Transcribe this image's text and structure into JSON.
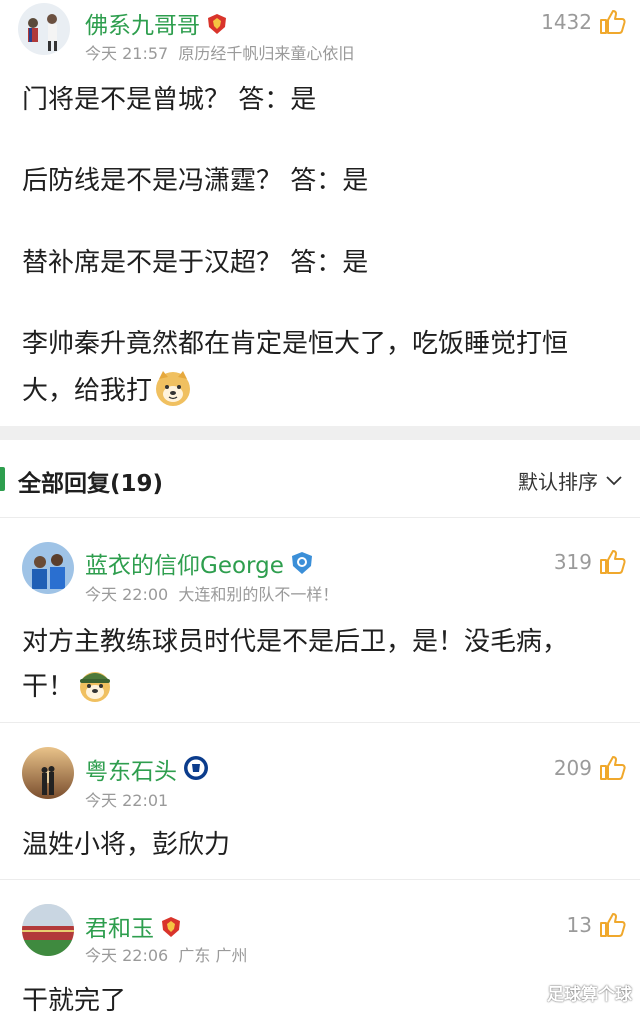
{
  "post": {
    "username": "佛系九哥哥",
    "time": "今天 21:57",
    "signature": "原历经千帆归来童心依旧",
    "likes": "1432",
    "lines": [
      "门将是不是曾城？ 答：是",
      "后防线是不是冯潇霆？ 答：是",
      "替补席是不是于汉超？ 答：是",
      "李帅秦升竟然都在肯定是恒大了，吃饭睡觉打恒",
      "大，给我打"
    ]
  },
  "replies_header": {
    "title": "全部回复(19)",
    "sort_label": "默认排序"
  },
  "replies": [
    {
      "username": "蓝衣的信仰George",
      "time": "今天 22:00",
      "signature": "大连和别的队不一样！",
      "likes": "319",
      "lines": [
        "对方主教练球员时代是不是后卫，是！没毛病，",
        "干！"
      ]
    },
    {
      "username": "粤东石头",
      "time": "今天 22:01",
      "signature": "",
      "likes": "209",
      "lines": [
        "温姓小将，彭欣力"
      ]
    },
    {
      "username": "君和玉",
      "time": "今天 22:06",
      "signature": "广东 广州",
      "likes": "13",
      "lines": [
        "干就完了"
      ]
    }
  ],
  "watermark": "足球算个球",
  "colors": {
    "username": "#2e9e4e",
    "like_icon": "#f0a82c",
    "meta": "#9a9a9a",
    "accent_bar": "#2e9e4e"
  }
}
